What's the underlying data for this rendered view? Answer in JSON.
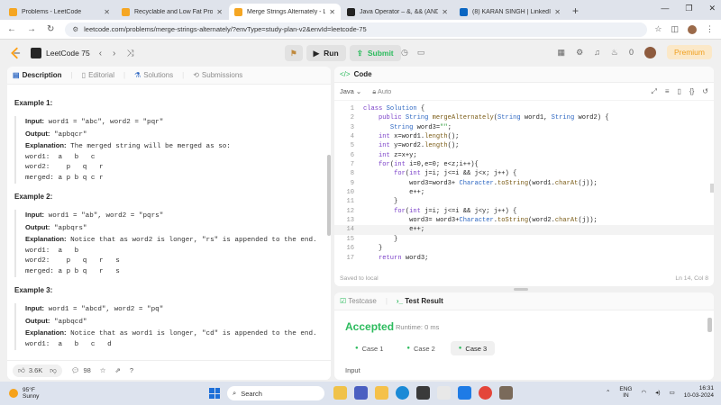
{
  "browser": {
    "tabs": [
      {
        "title": "Problems - LeetCode",
        "color": "#f5a623",
        "active": false
      },
      {
        "title": "Recyclable and Low Fat Products",
        "color": "#f5a623",
        "active": false
      },
      {
        "title": "Merge Strings Alternately - LeetCode",
        "color": "#f5a623",
        "active": true
      },
      {
        "title": "Java Operator – &, && (AND) ||",
        "color": "#222222",
        "active": false
      },
      {
        "title": "(8) KARAN SINGH | LinkedIn",
        "color": "#0a66c2",
        "active": false
      }
    ],
    "url": "leetcode.com/problems/merge-strings-alternately/?envType=study-plan-v2&envId=leetcode-75"
  },
  "header": {
    "list_name": "LeetCode 75",
    "run_label": "Run",
    "submit_label": "Submit",
    "streak": "0",
    "premium_label": "Premium"
  },
  "left": {
    "tabs": [
      "Description",
      "Editorial",
      "Solutions",
      "Submissions"
    ],
    "examples": [
      {
        "title": "Example 2:",
        "input": "word1 = \"ab\", word2 = \"pqrs\"",
        "output": "\"apbqrs\"",
        "explanation": "Notice that as word2 is longer, \"rs\" is appended to the end.",
        "lines": [
          "word1:  a   b",
          "word2:    p   q   r   s",
          "merged: a p b q   r   s"
        ]
      },
      {
        "title": "Example 3:",
        "input": "word1 = \"abcd\", word2 = \"pq\"",
        "output": "\"apbqcd\"",
        "explanation": "Notice that as word1 is longer, \"cd\" is appended to the end.",
        "lines": [
          "word1:  a   b   c   d"
        ]
      }
    ],
    "example1": {
      "title": "Example 1:",
      "input": "word1 = \"abc\", word2 = \"pqr\"",
      "output": "\"apbqcr\"",
      "explanation": "The merged string will be merged as so:",
      "lines": [
        "word1:  a   b   c",
        "word2:    p   q   r",
        "merged: a p b q c r"
      ]
    },
    "labels": {
      "input": "Input:",
      "output": "Output:",
      "explanation": "Explanation:"
    },
    "footer": {
      "likes": "3.6K",
      "comments": "98"
    }
  },
  "code": {
    "title": "Code",
    "language": "Java",
    "mode": "Auto",
    "lines": [
      "class Solution {",
      "    public String mergeAlternately(String word1, String word2) {",
      "       String word3=\"\";",
      "    int x=word1.length();",
      "    int y=word2.length();",
      "    int z=x+y;",
      "    for(int i=0,e=0; e<z;i++){",
      "        for(int j=i; j<=i && j<x; j++) {",
      "            word3=word3+ Character.toString(word1.charAt(j));",
      "            e++;",
      "        }",
      "        for(int j=i; j<=i && j<y; j++) {",
      "            word3= word3+Character.toString(word2.charAt(j));",
      "            e++;",
      "        }",
      "    }",
      "    return word3;"
    ],
    "highlight_line": 14,
    "saved_status": "Saved to local",
    "cursor": "Ln 14, Col 8"
  },
  "test": {
    "tabs": [
      "Testcase",
      "Test Result"
    ],
    "result": "Accepted",
    "runtime": "Runtime: 0 ms",
    "cases": [
      "Case 1",
      "Case 2",
      "Case 3"
    ],
    "active_case": 2,
    "input_label": "Input"
  },
  "taskbar": {
    "temp": "95°F",
    "weather": "Sunny",
    "search_placeholder": "Search",
    "lang1": "ENG",
    "lang2": "IN",
    "time": "16:31",
    "date": "10-03-2024"
  }
}
